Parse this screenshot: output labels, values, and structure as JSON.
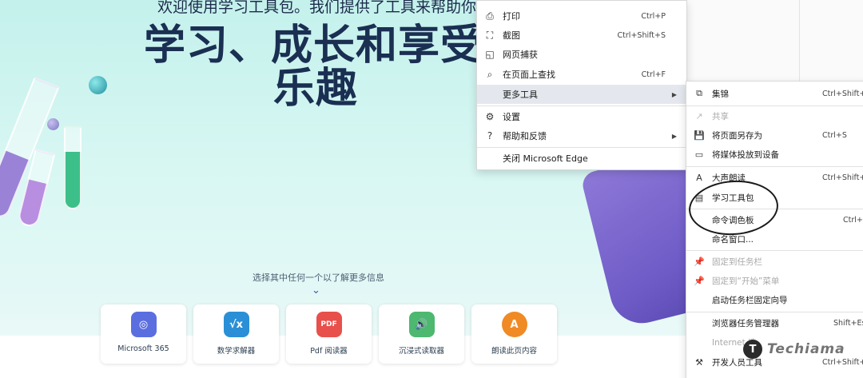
{
  "hero": {
    "intro": "欢迎使用学习工具包。我们提供了工具来帮助你",
    "title_line1": "学习、成长和享受",
    "title_line2": "乐趣",
    "hint": "选择其中任何一个以了解更多信息",
    "hint_arrow": "⌄"
  },
  "cards": [
    {
      "label": "Microsoft 365",
      "icon": "microsoft-365-icon",
      "color": "#5b6ee0",
      "glyph": "◎"
    },
    {
      "label": "数学求解器",
      "icon": "math-solver-icon",
      "color": "#2a8fd6",
      "glyph": "√x"
    },
    {
      "label": "Pdf 阅读器",
      "icon": "pdf-reader-icon",
      "color": "#e8504b",
      "glyph": "PDF"
    },
    {
      "label": "沉浸式读取器",
      "icon": "immersive-reader-icon",
      "color": "#4db870",
      "glyph": "🔊"
    },
    {
      "label": "朗读此页内容",
      "icon": "read-aloud-icon",
      "color": "#f08a24",
      "glyph": "A"
    }
  ],
  "menu": {
    "items": [
      {
        "label": "打印",
        "icon": "print-icon",
        "glyph": "⎙",
        "shortcut": "Ctrl+P"
      },
      {
        "label": "截图",
        "icon": "screenshot-icon",
        "glyph": "⛶",
        "shortcut": "Ctrl+Shift+S"
      },
      {
        "label": "网页捕获",
        "icon": "web-capture-icon",
        "glyph": "◱",
        "shortcut": ""
      },
      {
        "label": "在页面上查找",
        "icon": "find-icon",
        "glyph": "⌕",
        "shortcut": "Ctrl+F"
      },
      {
        "label": "更多工具",
        "icon": "more-tools-icon",
        "glyph": "",
        "shortcut": "",
        "arrow": "▶"
      },
      {
        "label": "设置",
        "icon": "settings-icon",
        "glyph": "⚙",
        "shortcut": ""
      },
      {
        "label": "帮助和反馈",
        "icon": "help-icon",
        "glyph": "?",
        "shortcut": "",
        "arrow": "▶"
      },
      {
        "label": "关闭 Microsoft Edge",
        "icon": "",
        "glyph": "",
        "shortcut": ""
      }
    ]
  },
  "submenu": {
    "items": [
      {
        "label": "集锦",
        "icon": "collections-icon",
        "glyph": "⧉",
        "shortcut": "Ctrl+Shift+Y"
      },
      {
        "label": "共享",
        "icon": "share-icon",
        "glyph": "↗",
        "shortcut": ""
      },
      {
        "label": "将页面另存为",
        "icon": "save-page-icon",
        "glyph": "💾",
        "shortcut": "Ctrl+S"
      },
      {
        "label": "将媒体投放到设备",
        "icon": "cast-icon",
        "glyph": "▭",
        "shortcut": ""
      },
      {
        "label": "大声朗读",
        "icon": "read-aloud-icon",
        "glyph": "A",
        "shortcut": "Ctrl+Shift+U"
      },
      {
        "label": "学习工具包",
        "icon": "learning-toolkit-icon",
        "glyph": "▤",
        "shortcut": ""
      },
      {
        "label": "命令调色板",
        "icon": "",
        "glyph": "",
        "shortcut": "Ctrl+Q"
      },
      {
        "label": "命名窗口...",
        "icon": "",
        "glyph": "",
        "shortcut": ""
      },
      {
        "label": "固定到任务栏",
        "icon": "pin-icon",
        "glyph": "📌",
        "shortcut": ""
      },
      {
        "label": "固定到“开始”菜单",
        "icon": "pin-start-icon",
        "glyph": "📌",
        "shortcut": ""
      },
      {
        "label": "启动任务栏固定向导",
        "icon": "",
        "glyph": "",
        "shortcut": ""
      },
      {
        "label": "浏览器任务管理器",
        "icon": "",
        "glyph": "",
        "shortcut": "Shift+Esc"
      },
      {
        "label": "Internet 选",
        "icon": "",
        "glyph": "",
        "shortcut": ""
      },
      {
        "label": "开发人员工具",
        "icon": "devtools-icon",
        "glyph": "⚒",
        "shortcut": "Ctrl+Shift+I"
      }
    ]
  },
  "watermark": {
    "logo": "T",
    "text": "Techiama"
  }
}
